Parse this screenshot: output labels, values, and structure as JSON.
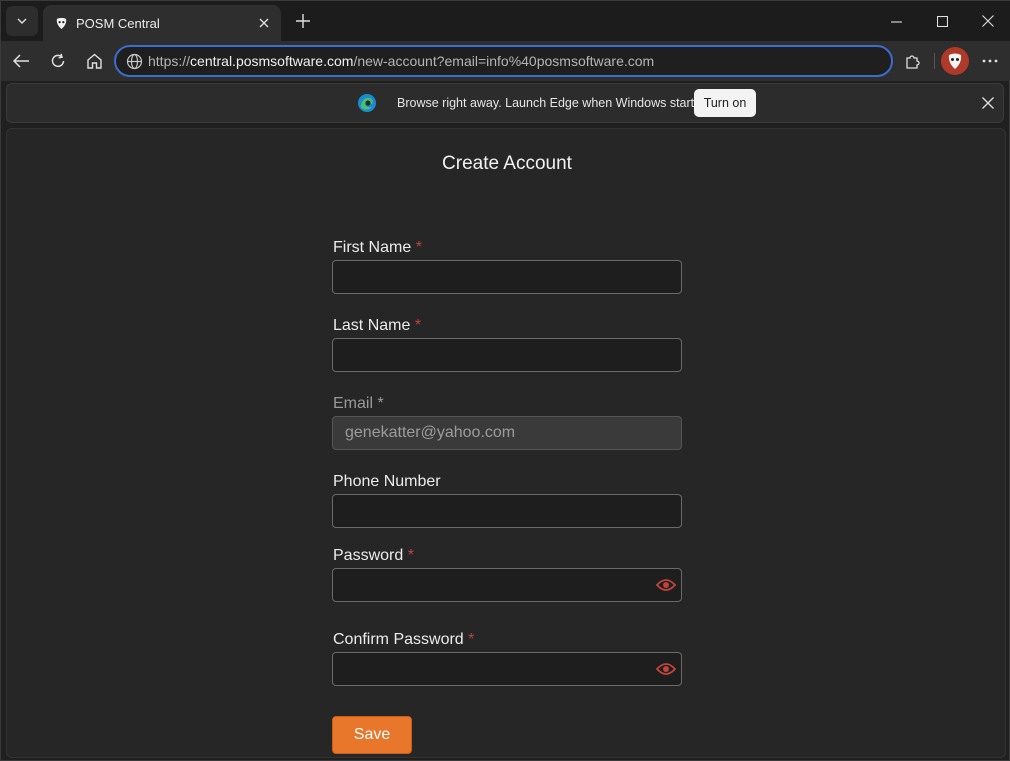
{
  "browser": {
    "tab_title": "POSM Central",
    "url_scheme": "https://",
    "url_host": "central.posmsoftware.com",
    "url_path": "/new-account?email=info%40posmsoftware.com",
    "accent_color": "#3a6ecf"
  },
  "infobar": {
    "message": "Browse right away. Launch Edge when Windows starts.",
    "button_label": "Turn on"
  },
  "form": {
    "title": "Create Account",
    "required_marker": "*",
    "first_name": {
      "label": "First Name",
      "value": ""
    },
    "last_name": {
      "label": "Last Name",
      "value": ""
    },
    "email": {
      "label": "Email",
      "value": "genekatter@yahoo.com"
    },
    "phone": {
      "label": "Phone Number",
      "value": ""
    },
    "password": {
      "label": "Password",
      "value": ""
    },
    "confirm_password": {
      "label": "Confirm Password",
      "value": ""
    },
    "save_label": "Save",
    "save_color": "#e8762b",
    "required_color": "#c0443b"
  },
  "icons": [
    "tab-list-icon",
    "posm-favicon",
    "close-icon",
    "plus-icon",
    "minimize-icon",
    "maximize-icon",
    "back-icon",
    "refresh-icon",
    "home-icon",
    "globe-icon",
    "extensions-icon",
    "profile-icon",
    "more-icon",
    "edge-logo-icon",
    "eye-icon"
  ]
}
